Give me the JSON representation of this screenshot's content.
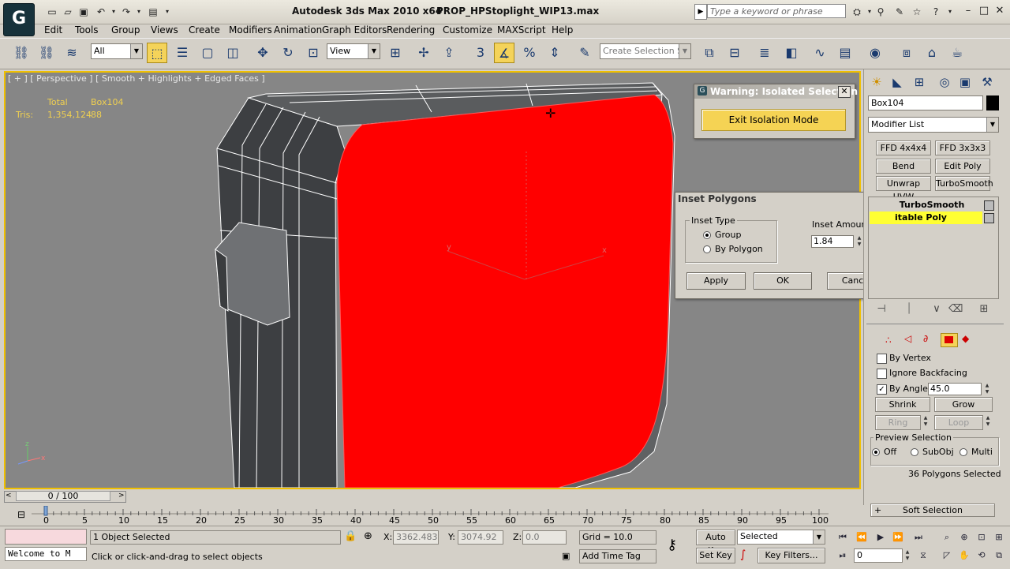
{
  "titlebar": {
    "app_title": "Autodesk 3ds Max  2010 x64",
    "file_title": "PROP_HPStoplight_WIP13.max",
    "search_placeholder": "Type a keyword or phrase"
  },
  "menu": [
    "Edit",
    "Tools",
    "Group",
    "Views",
    "Create",
    "Modifiers",
    "Animation",
    "Graph Editors",
    "Rendering",
    "Customize",
    "MAXScript",
    "Help"
  ],
  "toolbar": {
    "filter_value": "All",
    "ref_coord_value": "View",
    "named_selection_placeholder": "Create Selection Se"
  },
  "viewport": {
    "label": "[ + ] [ Perspective ] [ Smooth + Highlights + Edged Faces ]",
    "stats": {
      "total_label": "Total",
      "object_label": "Box104",
      "tris_label": "Tris:",
      "tris_total": "1,354,124",
      "tris_object": "88"
    },
    "selected_face_color": "#ff0000",
    "axis_labels": {
      "x": "x",
      "y": "y",
      "z": "z"
    }
  },
  "isolation_dialog": {
    "title": "Warning: Isolated Selection",
    "button": "Exit Isolation Mode",
    "button_color": "#f5d354"
  },
  "inset_dialog": {
    "title": "Inset Polygons",
    "group_title": "Inset Type",
    "option_group": "Group",
    "option_by_polygon": "By Polygon",
    "amount_label": "Inset Amount",
    "amount_value": "1.84",
    "apply": "Apply",
    "ok": "OK",
    "cancel": "Cancel"
  },
  "command_panel": {
    "object_name": "Box104",
    "modifier_list": "Modifier List",
    "modifier_buttons": [
      "FFD 4x4x4",
      "FFD 3x3x3",
      "Bend",
      "Edit Poly",
      "Unwrap UVW",
      "TurboSmooth"
    ],
    "stack": [
      "TurboSmooth",
      "itable Poly"
    ],
    "stack_highlight_color": "#ffff33",
    "by_vertex": "By Vertex",
    "ignore_backfacing": "Ignore Backfacing",
    "by_angle": "By Angle:",
    "by_angle_value": "45.0",
    "shrink": "Shrink",
    "grow": "Grow",
    "ring": "Ring",
    "loop": "Loop",
    "preview_selection": "Preview Selection",
    "preview_off": "Off",
    "preview_subobj": "SubObj",
    "preview_multi": "Multi",
    "selection_info": "36 Polygons Selected",
    "soft_selection": "Soft Selection",
    "soft_selection_sign": "+"
  },
  "timeline": {
    "slider_label": "0 / 100",
    "ticks": [
      "0",
      "5",
      "10",
      "15",
      "20",
      "25",
      "30",
      "35",
      "40",
      "45",
      "50",
      "55",
      "60",
      "65",
      "70",
      "75",
      "80",
      "85",
      "90",
      "95",
      "100"
    ]
  },
  "status": {
    "maxscript_text": "Welcome to M",
    "selection_status": "1 Object Selected",
    "prompt": "Click or click-and-drag to select objects",
    "x_label": "X:",
    "x_value": "3362.483",
    "y_label": "Y:",
    "y_value": "3074.92",
    "z_label": "Z:",
    "z_value": "0.0",
    "grid": "Grid = 10.0",
    "auto_key": "Auto Key",
    "set_key": "Set Key",
    "key_mode_value": "Selected",
    "key_filters": "Key Filters...",
    "add_time_tag": "Add Time Tag",
    "frame_value": "0"
  }
}
